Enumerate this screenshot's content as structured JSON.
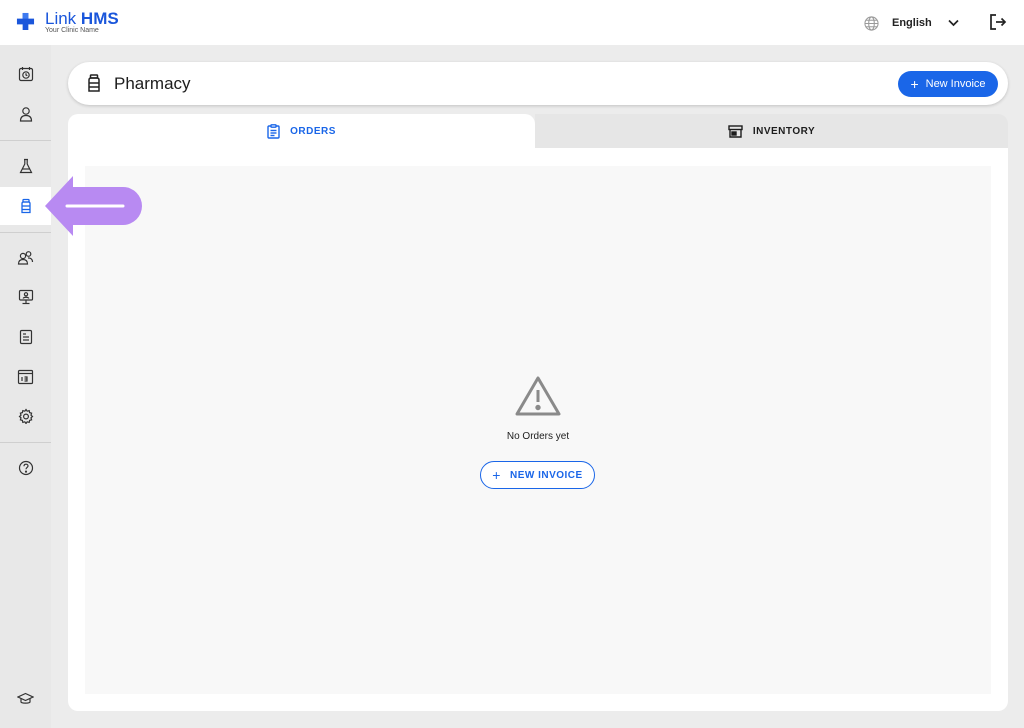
{
  "app": {
    "brand_link": "Link",
    "brand_hms": "HMS",
    "clinic_name": "Your Clinic Name"
  },
  "topbar": {
    "language_icon": "globe-icon",
    "language": "English",
    "logout_icon": "logout-icon"
  },
  "sidebar": {
    "items": [
      {
        "icon": "appointments-clock-icon"
      },
      {
        "icon": "patient-user-icon"
      },
      {
        "icon": "laboratory-flask-icon"
      },
      {
        "icon": "pharmacy-bottle-icon",
        "active": true
      },
      {
        "icon": "staff-users-icon"
      },
      {
        "icon": "monitor-display-icon"
      },
      {
        "icon": "report-document-icon"
      },
      {
        "icon": "statistics-chart-icon"
      },
      {
        "icon": "settings-gear-icon"
      },
      {
        "icon": "help-circle-icon"
      },
      {
        "icon": "education-cap-icon"
      }
    ]
  },
  "header": {
    "title": "Pharmacy",
    "new_invoice_label": "New Invoice",
    "new_invoice_icon": "plus-icon"
  },
  "tabs": [
    {
      "label": "ORDERS",
      "icon": "clipboard-list-icon",
      "active": true
    },
    {
      "label": "INVENTORY",
      "icon": "store-icon",
      "active": false
    }
  ],
  "empty_state": {
    "icon": "warning-triangle-icon",
    "message": "No Orders yet",
    "button_label": "NEW INVOICE"
  },
  "colors": {
    "accent": "#1a66e8",
    "annotation_arrow": "#b88af2"
  }
}
